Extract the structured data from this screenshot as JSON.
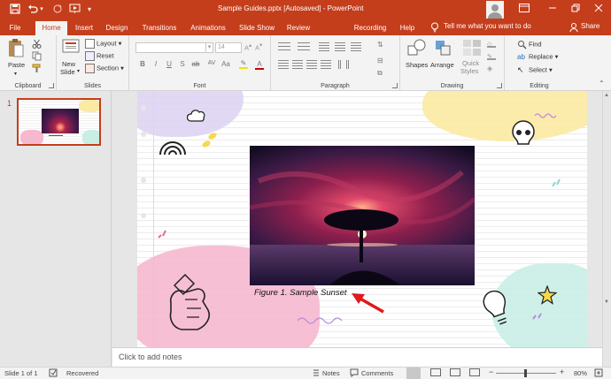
{
  "titlebar": {
    "title": "Sample Guides.pptx [Autosaved]  -  PowerPoint",
    "icons": [
      "save-icon",
      "undo-icon",
      "redo-icon",
      "start-from-beginning-icon",
      "customize-toolbar-icon"
    ],
    "window_controls": [
      "minimize",
      "restore",
      "close"
    ]
  },
  "tabs": [
    "File",
    "Home",
    "Insert",
    "Design",
    "Transitions",
    "Animations",
    "Slide Show",
    "Review",
    "Recording",
    "Help"
  ],
  "active_tab": "Home",
  "tell_me": "Tell me what you want to do",
  "share_label": "Share",
  "ribbon": {
    "clipboard": {
      "label": "Clipboard",
      "paste": "Paste"
    },
    "slides": {
      "label": "Slides",
      "new_slide_line1": "New",
      "new_slide_line2": "Slide",
      "layout": "Layout",
      "reset": "Reset",
      "section": "Section"
    },
    "font": {
      "label": "Font",
      "font_size": "14"
    },
    "paragraph": {
      "label": "Paragraph"
    },
    "drawing": {
      "label": "Drawing",
      "shapes": "Shapes",
      "arrange": "Arrange",
      "quick_styles_line1": "Quick",
      "quick_styles_line2": "Styles"
    },
    "editing": {
      "label": "Editing",
      "find": "Find",
      "replace": "Replace",
      "select": "Select"
    }
  },
  "thumbnail": {
    "number": "1"
  },
  "slide": {
    "caption": "Figure 1. Sample Sunset"
  },
  "notes_placeholder": "Click to add notes",
  "status": {
    "slide_info": "Slide 1 of 1",
    "recovered": "Recovered",
    "notes": "Notes",
    "comments": "Comments",
    "zoom": "80%"
  },
  "colors": {
    "accent": "#c43e1c",
    "arrow": "#e0191b",
    "pink_blob": "#f6b8cf",
    "yellow_blob": "#fbeaa3",
    "mint_blob": "#c9eee6",
    "lilac_blob": "#dcd2f2"
  }
}
